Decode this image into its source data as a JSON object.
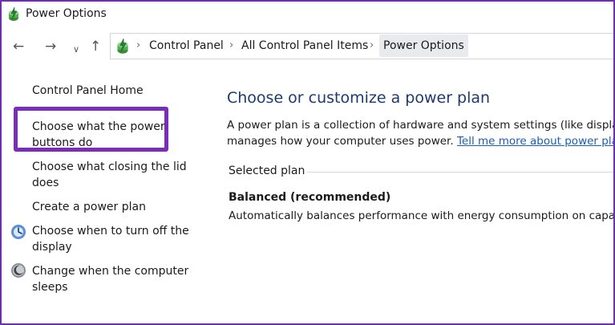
{
  "window": {
    "title": "Power Options"
  },
  "nav": {
    "back": "←",
    "forward": "→",
    "recent": "∨",
    "up": "↑"
  },
  "breadcrumb": {
    "items": [
      "Control Panel",
      "All Control Panel Items",
      "Power Options"
    ],
    "separator": "›"
  },
  "sidebar": {
    "items": [
      {
        "label": "Control Panel Home"
      },
      {
        "label_line1": "Choose what the power",
        "label_line2": "buttons do"
      },
      {
        "label_line1": "Choose what closing the lid",
        "label_line2": "does"
      },
      {
        "label": "Create a power plan"
      },
      {
        "label_line1": "Choose when to turn off the",
        "label_line2": "display",
        "icon": "display-icon"
      },
      {
        "label_line1": "Change when the computer",
        "label_line2": "sleeps",
        "icon": "sleep-icon"
      }
    ],
    "highlight_color": "#7a2db8"
  },
  "main": {
    "heading": "Choose or customize a power plan",
    "desc_line1": "A power plan is a collection of hardware and system settings (like display",
    "desc_line2_prefix": "manages how your computer uses power. ",
    "desc_link": "Tell me more about power plan",
    "selected_plan_label": "Selected plan",
    "plan_name": "Balanced (recommended)",
    "plan_desc": "Automatically balances performance with energy consumption on capab"
  },
  "colors": {
    "frame": "#6b2fb0",
    "heading": "#1e3a6e",
    "link": "#1a5fb4"
  }
}
